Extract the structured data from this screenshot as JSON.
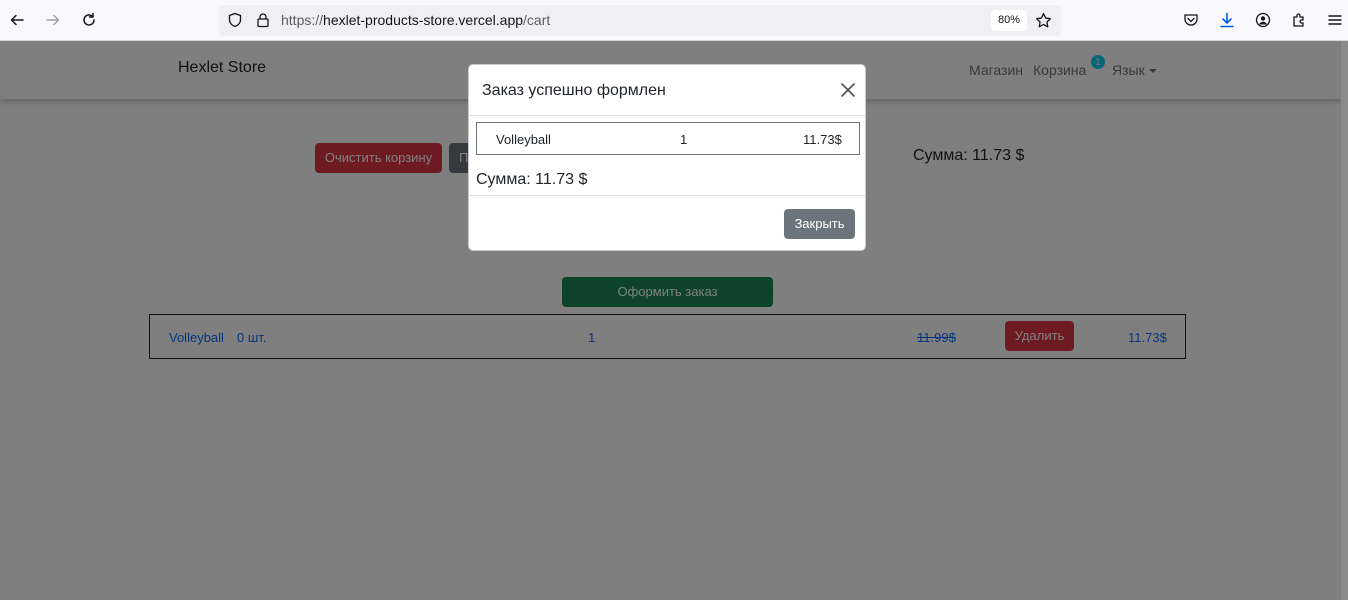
{
  "browser": {
    "url_prefix": "https://",
    "url_host": "hexlet-products-store.vercel.app",
    "url_path": "/cart",
    "zoom": "80%"
  },
  "navbar": {
    "brand": "Hexlet Store",
    "links": {
      "shop": "Магазин",
      "cart": "Корзина",
      "lang": "Язык"
    },
    "cart_count": "1",
    "badge_color": "#0dcaf0"
  },
  "cart": {
    "clear_label": "Очистить корзину",
    "dark_button_label": "П",
    "sum_label": "Сумма: 11.73 $",
    "order_label": "Оформить заказ",
    "row": {
      "name": "Volleyball",
      "qty_text": "0 шт.",
      "count": "1",
      "old_price": "11.99$",
      "delete_label": "Удалить",
      "price": "11.73$"
    }
  },
  "modal": {
    "title": "Заказ успешно формлен",
    "item": {
      "name": "Volleyball",
      "qty": "1",
      "price": "11.73$"
    },
    "sum": "Сумма: 11.73 $",
    "close_label": "Закрыть"
  },
  "colors": {
    "danger": "#dc3545",
    "secondary": "#6c757d",
    "success": "#198754",
    "link": "#0d6efd"
  }
}
